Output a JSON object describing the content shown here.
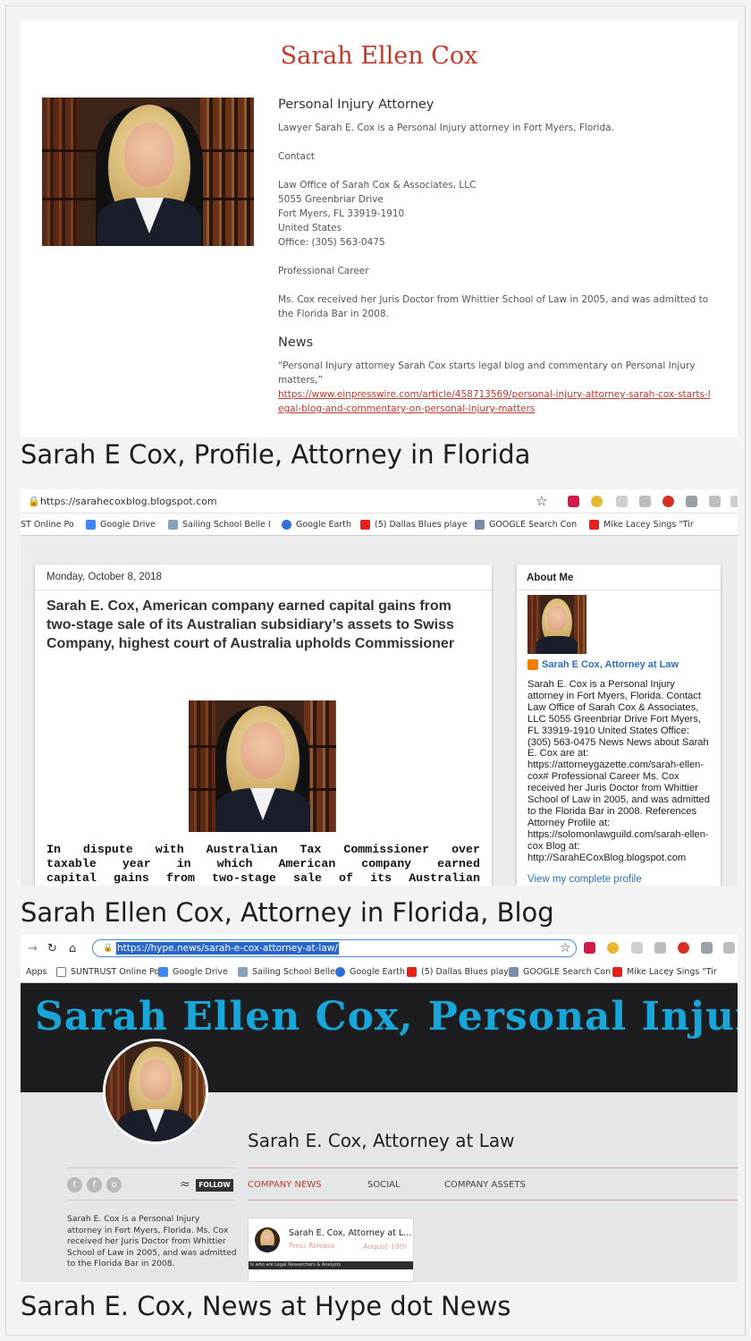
{
  "panel1": {
    "name": "Sarah Ellen Cox",
    "heading": "Personal Injury Attorney",
    "intro": "Lawyer Sarah E. Cox is a Personal Injury attorney in Fort Myers, Florida.",
    "contact_label": "Contact",
    "address_lines": [
      "Law Office of Sarah Cox & Associates, LLC",
      "5055 Greenbriar Drive",
      "Fort Myers, FL 33919-1910",
      "United States",
      "Office: (305) 563-0475"
    ],
    "career_label": "Professional Career",
    "career_text": "Ms. Cox received her Juris Doctor from Whittier School of Law in 2005, and was admitted to the Florida Bar in 2008.",
    "news_label": "News",
    "news_quote": "“Personal Injury attorney Sarah Cox starts legal blog and commentary on Personal Injury matters,”",
    "news_link": "https://www.einpresswire.com/article/458713569/personal-injury-attorney-sarah-cox-starts-legal-blog-and-commentary-on-personal-injury-matters"
  },
  "caption1": "Sarah E Cox, Profile, Attorney in Florida",
  "panel2": {
    "url": "https://sarahecoxblog.blogspot.com",
    "bookmarks": [
      "ST Online Po",
      "Google Drive",
      "Sailing School Belle I",
      "Google Earth",
      "(5) Dallas Blues playe",
      "GOOGLE Search Con",
      "Mike Lacey Sings \"Tir"
    ],
    "post_date": "Monday, October 8, 2018",
    "post_title": "Sarah E. Cox, American company earned capital gains from two-stage sale of its Australian subsidiary’s assets to Swiss Company, highest court of Australia upholds Commissioner",
    "post_body_lines": [
      "In dispute with Australian Tax Commissioner over",
      "taxable year in which American company earned",
      "capital gains from two-stage sale of its Australian"
    ],
    "about_heading": "About Me",
    "about_name": "Sarah E Cox, Attorney at Law",
    "about_text": "Sarah E. Cox is a Personal Injury attorney in Fort Myers, Florida. Contact Law Office of Sarah Cox & Associates, LLC 5055 Greenbriar Drive Fort Myers, FL 33919-1910 United States Office: (305) 563-0475 News News about Sarah E. Cox are at: https://attorneygazette.com/sarah-ellen-cox# Professional Career Ms. Cox received her Juris Doctor from Whittier School of Law in 2005, and was admitted to the Florida Bar in 2008. References Attorney Profile at: https://solomonlawguild.com/sarah-ellen-cox Blog at: http://SarahECoxBlog.blogspot.com",
    "view_profile": "View my complete profile"
  },
  "caption2": "Sarah Ellen Cox, Attorney in Florida, Blog",
  "panel3": {
    "url": "https://hype.news/sarah-e-cox-attorney-at-law/",
    "apps_label": "Apps",
    "bookmarks": [
      "SUNTRUST Online Po",
      "Google Drive",
      "Sailing School Belle I",
      "Google Earth",
      "(5) Dallas Blues playe",
      "GOOGLE Search Con",
      "Mike Lacey Sings \"Tir"
    ],
    "banner_title": "Sarah Ellen Cox, Personal Injury A",
    "profile_title": "Sarah E. Cox, Attorney at Law",
    "follow_label": "FOLLOW",
    "tabs": [
      "COMPANY NEWS",
      "SOCIAL",
      "COMPANY ASSETS"
    ],
    "bio": "Sarah E. Cox is a Personal Injury attorney in Fort Myers, Florida. Ms. Cox received her Juris Doctor from Whittier School of Law in 2005, and was admitted to the Florida Bar in 2008.",
    "card_title": "Sarah E. Cox, Attorney at L...",
    "card_subtitle": "Press Release",
    "card_date": "August 19th",
    "card_strip": "ls who are Legal Researchers & Analysts"
  },
  "caption3": "Sarah E. Cox, News at Hype dot News",
  "colors": {
    "accent_red": "#c0392b",
    "blog_blue": "#2a6ec0",
    "banner_blue": "#18a5d8"
  }
}
